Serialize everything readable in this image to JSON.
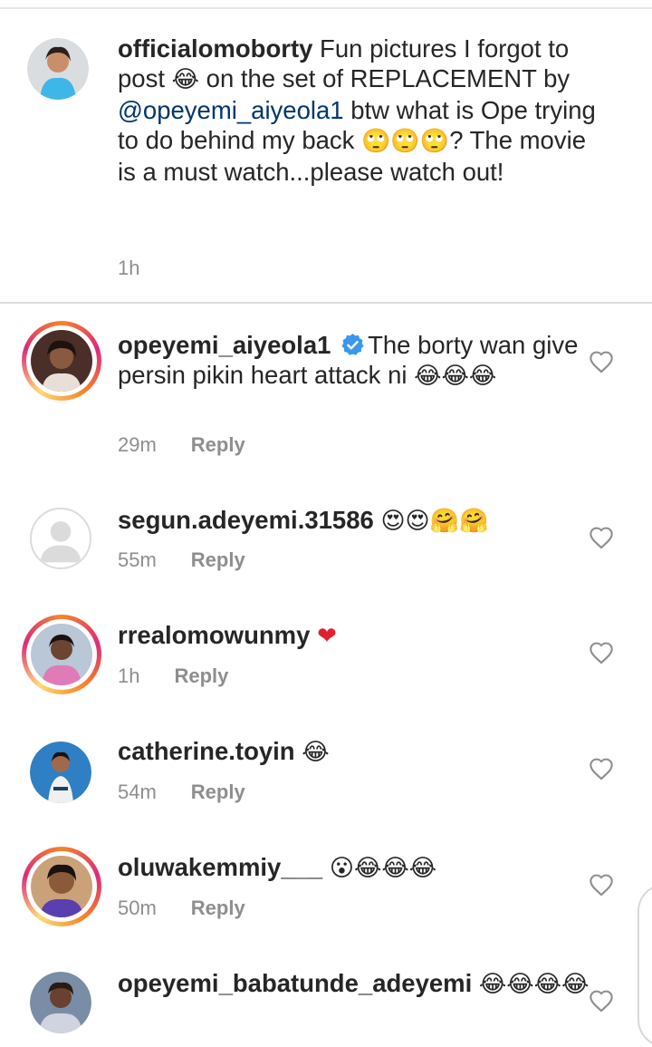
{
  "caption": {
    "username": "officialomoborty",
    "text_part1": " Fun pictures I forgot to post ",
    "emoji1": "😂",
    "text_part2": " on the set of REPLACEMENT by ",
    "mention": "@opeyemi_aiyeola1",
    "text_part3": " btw what is Ope trying to do behind my back ",
    "emoji2": "🙄🙄🙄",
    "text_part4": "? The movie is a must watch...please watch out!",
    "time": "1h"
  },
  "comments": [
    {
      "username": "opeyemi_aiyeola1",
      "verified": true,
      "text": "The borty wan give persin pikin heart attack ni ",
      "emoji": "😂😂😂",
      "time": "29m",
      "reply_label": "Reply",
      "avatar_color": "#7a4a3a"
    },
    {
      "username": "segun.adeyemi.31586",
      "text": " ",
      "emoji": "😍😍🤗🤗",
      "time": "55m",
      "reply_label": "Reply"
    },
    {
      "username": "rrealomowunmy",
      "text": " ",
      "emoji": "❤",
      "time": "1h",
      "reply_label": "Reply",
      "avatar_color": "#d89abf"
    },
    {
      "username": "catherine.toyin",
      "text": " ",
      "emoji": "😂",
      "time": "54m",
      "reply_label": "Reply",
      "avatar_color": "#3a8fd0"
    },
    {
      "username": "oluwakemmiy___",
      "text": " ",
      "emoji": "😮😂😂😂",
      "time": "50m",
      "reply_label": "Reply",
      "avatar_color": "#b06a3a"
    },
    {
      "username": "opeyemi_babatunde_adeyemi",
      "text": " ",
      "emoji": "😂😂😂😂",
      "avatar_color": "#6a7f9a"
    }
  ],
  "colors": {
    "text": "#262626",
    "muted": "#8e8e8e",
    "story_ring": "#dd2a7b",
    "verified": "#3897f0",
    "heart_red": "#e0212d"
  },
  "icons": {
    "like": "heart-outline-icon",
    "verified": "verified-badge-icon"
  }
}
